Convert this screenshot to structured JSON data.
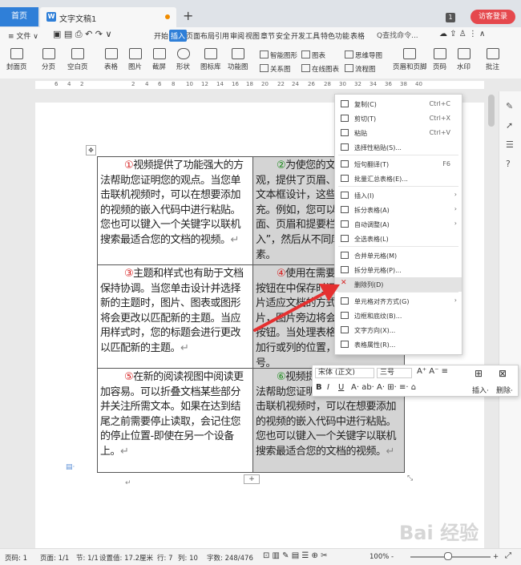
{
  "titlebar": {
    "home_tab": "首页",
    "doc_tab": "文字文稿1",
    "new_tab": "+",
    "window_count": "1",
    "login_button": "访客登录",
    "minimize": "—",
    "restore": "❐",
    "close": "✕"
  },
  "menubar": {
    "file": "≡ 文件 ∨",
    "items": [
      "开始",
      "插入",
      "页面布局",
      "引用",
      "审阅",
      "视图",
      "章节",
      "安全",
      "开发工具",
      "特色功能",
      "表格"
    ],
    "active": "插入",
    "search": "Q查找命令..."
  },
  "ribbon": {
    "buttons": [
      "封面页",
      "分页",
      "空白页",
      "表格",
      "图片",
      "截屏",
      "形状",
      "图标库",
      "功能图",
      "智能图形",
      "图表",
      "关系图",
      "在线图表",
      "思维导图",
      "流程图",
      "页眉和页脚",
      "页码",
      "水印",
      "批注"
    ]
  },
  "ruler": {
    "numbers": [
      "6",
      "4",
      "2",
      "2",
      "4",
      "6",
      "8",
      "10",
      "12",
      "14",
      "16",
      "18",
      "20",
      "22",
      "24",
      "26",
      "28",
      "30",
      "32",
      "34",
      "36",
      "38",
      "40"
    ]
  },
  "table": {
    "r1c1_num": "①",
    "r1c1": "视频提供了功能强大的方法帮助您证明您的观点。当您单击联机视频时，可以在想要添加的视频的嵌入代码中进行粘贴。您也可以键入一个关键字以联机搜索最适合您的文档的视频。",
    "r1c2_num": "②",
    "r1c2": "为使您的文档具有专业外观，提供了页眉、页脚、封面和文本框设计，这些设计可互为补充。例如，您可以添加匹配的封面、页眉和提要栏。单击“插入”，然后从不同库中选择所需元素。",
    "r2c1_num": "③",
    "r2c1": "主题和样式也有助于文档保持协调。当您单击设计并选择新的主题时，图片、图表或图形将会更改以匹配新的主题。当应用样式时，您的标题会进行更改以匹配新的主题。",
    "r2c2_num": "④",
    "r2c2": "使用在需要位置出现的新按钮在中保存时间。若要更改图片适应文档的方式，请单击该图片，图片旁边将会显示布局选项按钮。当处理表格时，单击要添加行或列的位置，然后单击加号。",
    "r3c1_num": "⑤",
    "r3c1": "在新的阅读视图中阅读更加容易。可以折叠文档某些部分并关注所需文本。如果在达到结尾之前需要停止读取，会记住您的停止位置-即使在另一个设备上。",
    "r3c2_num": "⑥",
    "r3c2": "视频提供了功能强大的方法帮助您证明您的观点。当您单击联机视频时，可以在想要添加的视频的嵌入代码中进行粘贴。您也可以键入一个关键字以联机搜索最适合您的文档的视频。",
    "para_mark": "↵"
  },
  "context_menu": [
    {
      "label": "复制(C)",
      "shortcut": "Ctrl+C",
      "sub": false
    },
    {
      "label": "剪切(T)",
      "shortcut": "Ctrl+X",
      "sub": false
    },
    {
      "label": "粘贴",
      "shortcut": "Ctrl+V",
      "sub": false
    },
    {
      "label": "选择性粘贴(S)...",
      "shortcut": "",
      "sub": false
    },
    {
      "label": "短句翻译(T)",
      "shortcut": "F6",
      "sub": false
    },
    {
      "label": "批量汇总表格(E)...",
      "shortcut": "",
      "sub": false
    },
    {
      "label": "插入(I)",
      "shortcut": "",
      "sub": true
    },
    {
      "label": "拆分表格(A)",
      "shortcut": "",
      "sub": true
    },
    {
      "label": "自动调整(A)",
      "shortcut": "",
      "sub": true
    },
    {
      "label": "全选表格(L)",
      "shortcut": "",
      "sub": false
    },
    {
      "label": "合并单元格(M)",
      "shortcut": "",
      "sub": false
    },
    {
      "label": "拆分单元格(P)...",
      "shortcut": "",
      "sub": false
    },
    {
      "label": "删除列(D)",
      "shortcut": "",
      "sub": false
    },
    {
      "label": "单元格对齐方式(G)",
      "shortcut": "",
      "sub": true
    },
    {
      "label": "边框和底纹(B)...",
      "shortcut": "",
      "sub": false
    },
    {
      "label": "文字方向(X)...",
      "shortcut": "",
      "sub": false
    },
    {
      "label": "表格属性(R)...",
      "shortcut": "",
      "sub": false
    }
  ],
  "mini_toolbar": {
    "font": "宋体 (正文)",
    "size": "三号",
    "insert": "插入·",
    "delete": "删除·"
  },
  "statusbar": {
    "page": "页码: 1",
    "pages": "页面: 1/1",
    "section": "节: 1/1",
    "setting": "设置值: 17.2厘米",
    "row": "行: 7",
    "col": "列: 10",
    "words": "字数: 248/476",
    "zoom": "100% -",
    "zoom_plus": "+"
  },
  "watermark": "Bai 经验"
}
